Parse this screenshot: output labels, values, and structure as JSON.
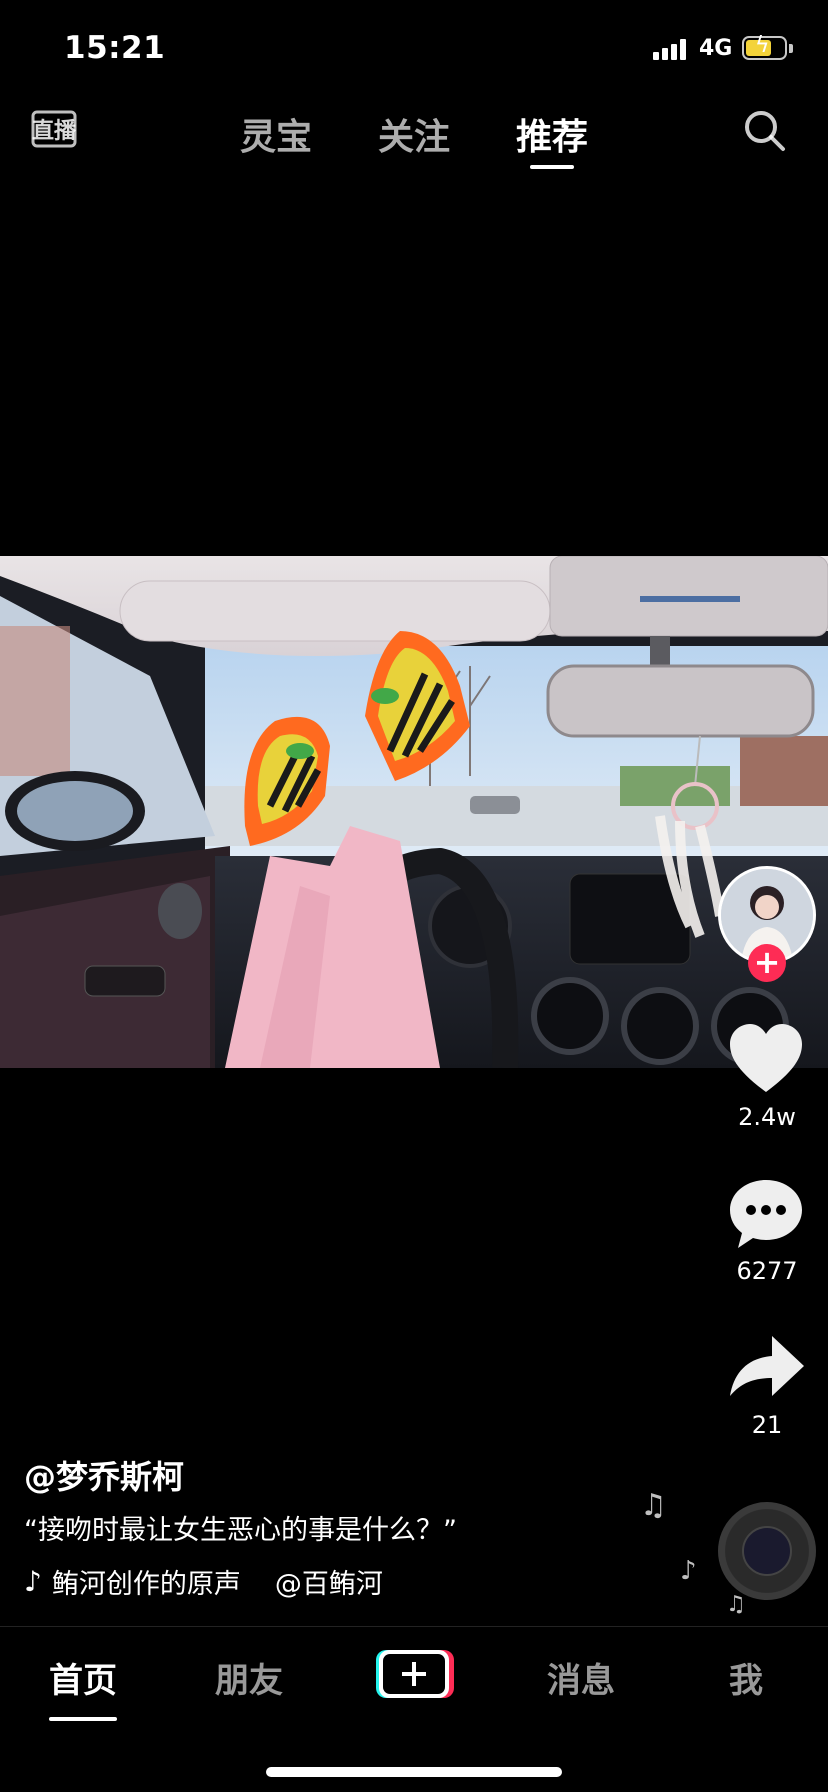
{
  "status_bar": {
    "time": "15:21",
    "network": "4G"
  },
  "top_nav": {
    "tabs": [
      {
        "label": "灵宝"
      },
      {
        "label": "关注"
      },
      {
        "label": "推荐"
      }
    ],
    "active_tab": "推荐"
  },
  "video": {
    "description": "car interior, legs with orange-and-yellow sneakers on the dashboard"
  },
  "actions": {
    "likes": "2.4w",
    "comments": "6277",
    "shares": "21"
  },
  "post": {
    "author": "@梦乔斯柯",
    "caption": "“接吻时最让女生恶心的事是什么？”",
    "music": "鲔河创作的原声",
    "music_mention": "@百鲔河"
  },
  "bottom_nav": {
    "tabs": [
      {
        "label": "首页"
      },
      {
        "label": "朋友"
      },
      {
        "label": "消息"
      },
      {
        "label": "我"
      }
    ],
    "active_tab": "首页"
  },
  "colors": {
    "background": "#000000",
    "accent_red": "#fe2c55",
    "accent_cyan": "#25f4ee",
    "battery": "#f3d33a"
  }
}
